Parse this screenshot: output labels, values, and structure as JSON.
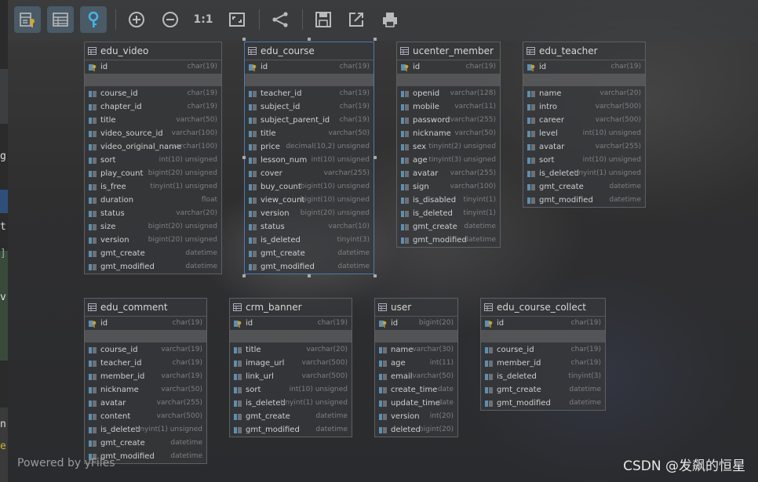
{
  "toolbar": {
    "buttons": [
      {
        "name": "key-diagram-icon",
        "x": 0
      },
      {
        "name": "table-list-icon"
      },
      {
        "name": "key-icon"
      },
      {
        "name": "zoom-in-icon"
      },
      {
        "name": "zoom-out-icon"
      },
      {
        "name": "actual-size-icon",
        "label": "1:1"
      },
      {
        "name": "fit-window-icon"
      },
      {
        "name": "share-icon"
      },
      {
        "name": "save-icon"
      },
      {
        "name": "export-icon"
      },
      {
        "name": "print-icon"
      }
    ]
  },
  "tables": {
    "edu_video": {
      "title": "edu_video",
      "pk": {
        "name": "id",
        "type": "char(19)"
      },
      "columns": [
        {
          "name": "course_id",
          "type": "char(19)"
        },
        {
          "name": "chapter_id",
          "type": "char(19)"
        },
        {
          "name": "title",
          "type": "varchar(50)"
        },
        {
          "name": "video_source_id",
          "type": "varchar(100)"
        },
        {
          "name": "video_original_name",
          "type": "varchar(100)"
        },
        {
          "name": "sort",
          "type": "int(10) unsigned"
        },
        {
          "name": "play_count",
          "type": "bigint(20) unsigned"
        },
        {
          "name": "is_free",
          "type": "tinyint(1) unsigned"
        },
        {
          "name": "duration",
          "type": "float"
        },
        {
          "name": "status",
          "type": "varchar(20)"
        },
        {
          "name": "size",
          "type": "bigint(20) unsigned"
        },
        {
          "name": "version",
          "type": "bigint(20) unsigned"
        },
        {
          "name": "gmt_create",
          "type": "datetime"
        },
        {
          "name": "gmt_modified",
          "type": "datetime"
        }
      ]
    },
    "edu_course": {
      "title": "edu_course",
      "pk": {
        "name": "id",
        "type": "char(19)"
      },
      "columns": [
        {
          "name": "teacher_id",
          "type": "char(19)"
        },
        {
          "name": "subject_id",
          "type": "char(19)"
        },
        {
          "name": "subject_parent_id",
          "type": "char(19)"
        },
        {
          "name": "title",
          "type": "varchar(50)"
        },
        {
          "name": "price",
          "type": "decimal(10,2) unsigned"
        },
        {
          "name": "lesson_num",
          "type": "int(10) unsigned"
        },
        {
          "name": "cover",
          "type": "varchar(255)"
        },
        {
          "name": "buy_count",
          "type": "bigint(10) unsigned"
        },
        {
          "name": "view_count",
          "type": "bigint(10) unsigned"
        },
        {
          "name": "version",
          "type": "bigint(20) unsigned"
        },
        {
          "name": "status",
          "type": "varchar(10)"
        },
        {
          "name": "is_deleted",
          "type": "tinyint(3)"
        },
        {
          "name": "gmt_create",
          "type": "datetime"
        },
        {
          "name": "gmt_modified",
          "type": "datetime"
        }
      ]
    },
    "ucenter_member": {
      "title": "ucenter_member",
      "pk": {
        "name": "id",
        "type": "char(19)"
      },
      "columns": [
        {
          "name": "openid",
          "type": "varchar(128)"
        },
        {
          "name": "mobile",
          "type": "varchar(11)"
        },
        {
          "name": "password",
          "type": "varchar(255)"
        },
        {
          "name": "nickname",
          "type": "varchar(50)"
        },
        {
          "name": "sex",
          "type": "tinyint(2) unsigned"
        },
        {
          "name": "age",
          "type": "tinyint(3) unsigned"
        },
        {
          "name": "avatar",
          "type": "varchar(255)"
        },
        {
          "name": "sign",
          "type": "varchar(100)"
        },
        {
          "name": "is_disabled",
          "type": "tinyint(1)"
        },
        {
          "name": "is_deleted",
          "type": "tinyint(1)"
        },
        {
          "name": "gmt_create",
          "type": "datetime"
        },
        {
          "name": "gmt_modified",
          "type": "datetime"
        }
      ]
    },
    "edu_teacher": {
      "title": "edu_teacher",
      "pk": {
        "name": "id",
        "type": "char(19)"
      },
      "columns": [
        {
          "name": "name",
          "type": "varchar(20)"
        },
        {
          "name": "intro",
          "type": "varchar(500)"
        },
        {
          "name": "career",
          "type": "varchar(500)"
        },
        {
          "name": "level",
          "type": "int(10) unsigned"
        },
        {
          "name": "avatar",
          "type": "varchar(255)"
        },
        {
          "name": "sort",
          "type": "int(10) unsigned"
        },
        {
          "name": "is_deleted",
          "type": "tinyint(1) unsigned"
        },
        {
          "name": "gmt_create",
          "type": "datetime"
        },
        {
          "name": "gmt_modified",
          "type": "datetime"
        }
      ]
    },
    "edu_comment": {
      "title": "edu_comment",
      "pk": {
        "name": "id",
        "type": "char(19)"
      },
      "columns": [
        {
          "name": "course_id",
          "type": "varchar(19)"
        },
        {
          "name": "teacher_id",
          "type": "char(19)"
        },
        {
          "name": "member_id",
          "type": "varchar(19)"
        },
        {
          "name": "nickname",
          "type": "varchar(50)"
        },
        {
          "name": "avatar",
          "type": "varchar(255)"
        },
        {
          "name": "content",
          "type": "varchar(500)"
        },
        {
          "name": "is_deleted",
          "type": "tinyint(1) unsigned"
        },
        {
          "name": "gmt_create",
          "type": "datetime"
        },
        {
          "name": "gmt_modified",
          "type": "datetime"
        }
      ]
    },
    "crm_banner": {
      "title": "crm_banner",
      "pk": {
        "name": "id",
        "type": "char(19)"
      },
      "columns": [
        {
          "name": "title",
          "type": "varchar(20)"
        },
        {
          "name": "image_url",
          "type": "varchar(500)"
        },
        {
          "name": "link_url",
          "type": "varchar(500)"
        },
        {
          "name": "sort",
          "type": "int(10) unsigned"
        },
        {
          "name": "is_deleted",
          "type": "tinyint(1) unsigned"
        },
        {
          "name": "gmt_create",
          "type": "datetime"
        },
        {
          "name": "gmt_modified",
          "type": "datetime"
        }
      ]
    },
    "user": {
      "title": "user",
      "pk": {
        "name": "id",
        "type": "bigint(20)"
      },
      "columns": [
        {
          "name": "name",
          "type": "varchar(30)"
        },
        {
          "name": "age",
          "type": "int(11)"
        },
        {
          "name": "email",
          "type": "varchar(50)"
        },
        {
          "name": "create_time",
          "type": "date"
        },
        {
          "name": "update_time",
          "type": "date"
        },
        {
          "name": "version",
          "type": "int(20)"
        },
        {
          "name": "deleted",
          "type": "bigint(20)"
        }
      ]
    },
    "edu_course_collect": {
      "title": "edu_course_collect",
      "pk": {
        "name": "id",
        "type": "char(19)"
      },
      "columns": [
        {
          "name": "course_id",
          "type": "char(19)"
        },
        {
          "name": "member_id",
          "type": "char(19)"
        },
        {
          "name": "is_deleted",
          "type": "tinyint(3)"
        },
        {
          "name": "gmt_create",
          "type": "datetime"
        },
        {
          "name": "gmt_modified",
          "type": "datetime"
        }
      ]
    }
  },
  "footer": {
    "powered": "Powered by yFiles",
    "watermark": "CSDN @发飙的恒星"
  },
  "left_strip": {
    "glyphs": [
      "g",
      "t",
      "]",
      "v",
      "n",
      "e"
    ]
  },
  "colors": {
    "accent": "#4a7ab5",
    "key_icon": "#c9a230",
    "column_icon": "#5d8fb0"
  }
}
